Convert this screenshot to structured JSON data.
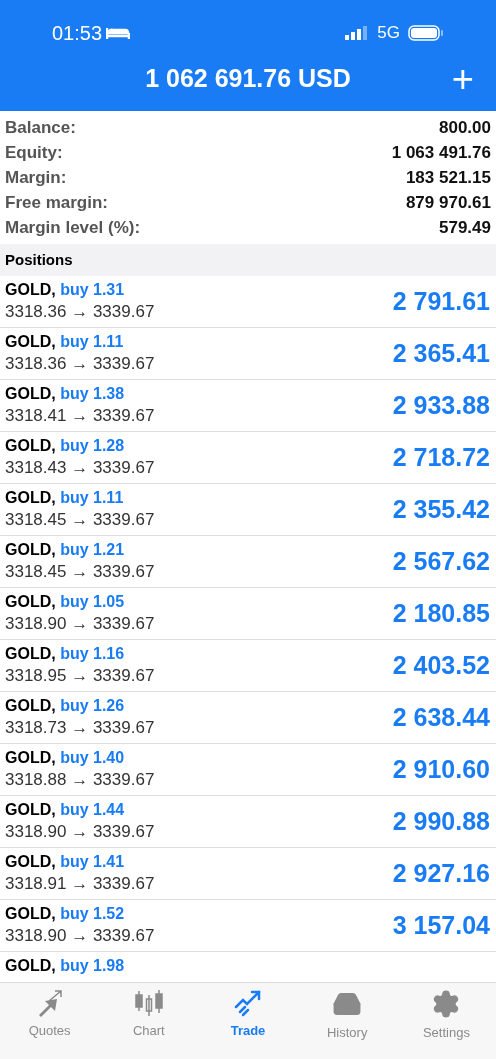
{
  "status_bar": {
    "time": "01:53",
    "network": "5G"
  },
  "header": {
    "title": "1 062 691.76 USD",
    "action": "+"
  },
  "summary": [
    {
      "label": "Balance:",
      "value": "800.00"
    },
    {
      "label": "Equity:",
      "value": "1 063 491.76"
    },
    {
      "label": "Margin:",
      "value": "183 521.15"
    },
    {
      "label": "Free margin:",
      "value": "879 970.61"
    },
    {
      "label": "Margin level (%):",
      "value": "579.49"
    }
  ],
  "positions_title": "Positions",
  "positions": [
    {
      "symbol": "GOLD,",
      "side": "buy 1.31",
      "prices": "3318.36 → 3339.67",
      "profit": "2 791.61"
    },
    {
      "symbol": "GOLD,",
      "side": "buy 1.11",
      "prices": "3318.36 → 3339.67",
      "profit": "2 365.41"
    },
    {
      "symbol": "GOLD,",
      "side": "buy 1.38",
      "prices": "3318.41 → 3339.67",
      "profit": "2 933.88"
    },
    {
      "symbol": "GOLD,",
      "side": "buy 1.28",
      "prices": "3318.43 → 3339.67",
      "profit": "2 718.72"
    },
    {
      "symbol": "GOLD,",
      "side": "buy 1.11",
      "prices": "3318.45 → 3339.67",
      "profit": "2 355.42"
    },
    {
      "symbol": "GOLD,",
      "side": "buy 1.21",
      "prices": "3318.45 → 3339.67",
      "profit": "2 567.62"
    },
    {
      "symbol": "GOLD,",
      "side": "buy 1.05",
      "prices": "3318.90 → 3339.67",
      "profit": "2 180.85"
    },
    {
      "symbol": "GOLD,",
      "side": "buy 1.16",
      "prices": "3318.95 → 3339.67",
      "profit": "2 403.52"
    },
    {
      "symbol": "GOLD,",
      "side": "buy 1.26",
      "prices": "3318.73 → 3339.67",
      "profit": "2 638.44"
    },
    {
      "symbol": "GOLD,",
      "side": "buy 1.40",
      "prices": "3318.88 → 3339.67",
      "profit": "2 910.60"
    },
    {
      "symbol": "GOLD,",
      "side": "buy 1.44",
      "prices": "3318.90 → 3339.67",
      "profit": "2 990.88"
    },
    {
      "symbol": "GOLD,",
      "side": "buy 1.41",
      "prices": "3318.91 → 3339.67",
      "profit": "2 927.16"
    },
    {
      "symbol": "GOLD,",
      "side": "buy 1.52",
      "prices": "3318.90 → 3339.67",
      "profit": "3 157.04"
    },
    {
      "symbol": "GOLD,",
      "side": "buy 1.98"
    }
  ],
  "tabs": [
    {
      "label": "Quotes",
      "kind": "quotes",
      "selected": false
    },
    {
      "label": "Chart",
      "kind": "chart",
      "selected": false
    },
    {
      "label": "Trade",
      "kind": "trade",
      "selected": true
    },
    {
      "label": "History",
      "kind": "history",
      "selected": false
    },
    {
      "label": "Settings",
      "kind": "settings",
      "selected": false
    }
  ]
}
